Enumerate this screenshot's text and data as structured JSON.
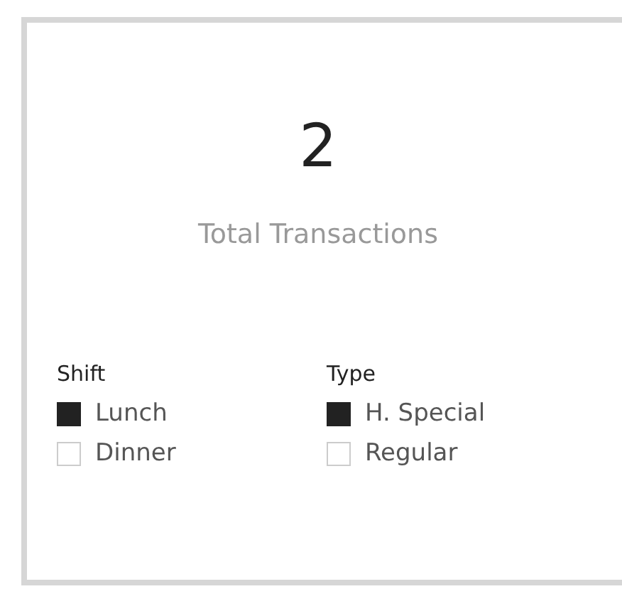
{
  "card": {
    "value": "2",
    "label": "Total Transactions"
  },
  "slicers": [
    {
      "title": "Shift",
      "items": [
        {
          "label": "Lunch",
          "checked": true
        },
        {
          "label": "Dinner",
          "checked": false
        }
      ]
    },
    {
      "title": "Type",
      "items": [
        {
          "label": "H. Special",
          "checked": true
        },
        {
          "label": "Regular",
          "checked": false
        }
      ]
    }
  ]
}
